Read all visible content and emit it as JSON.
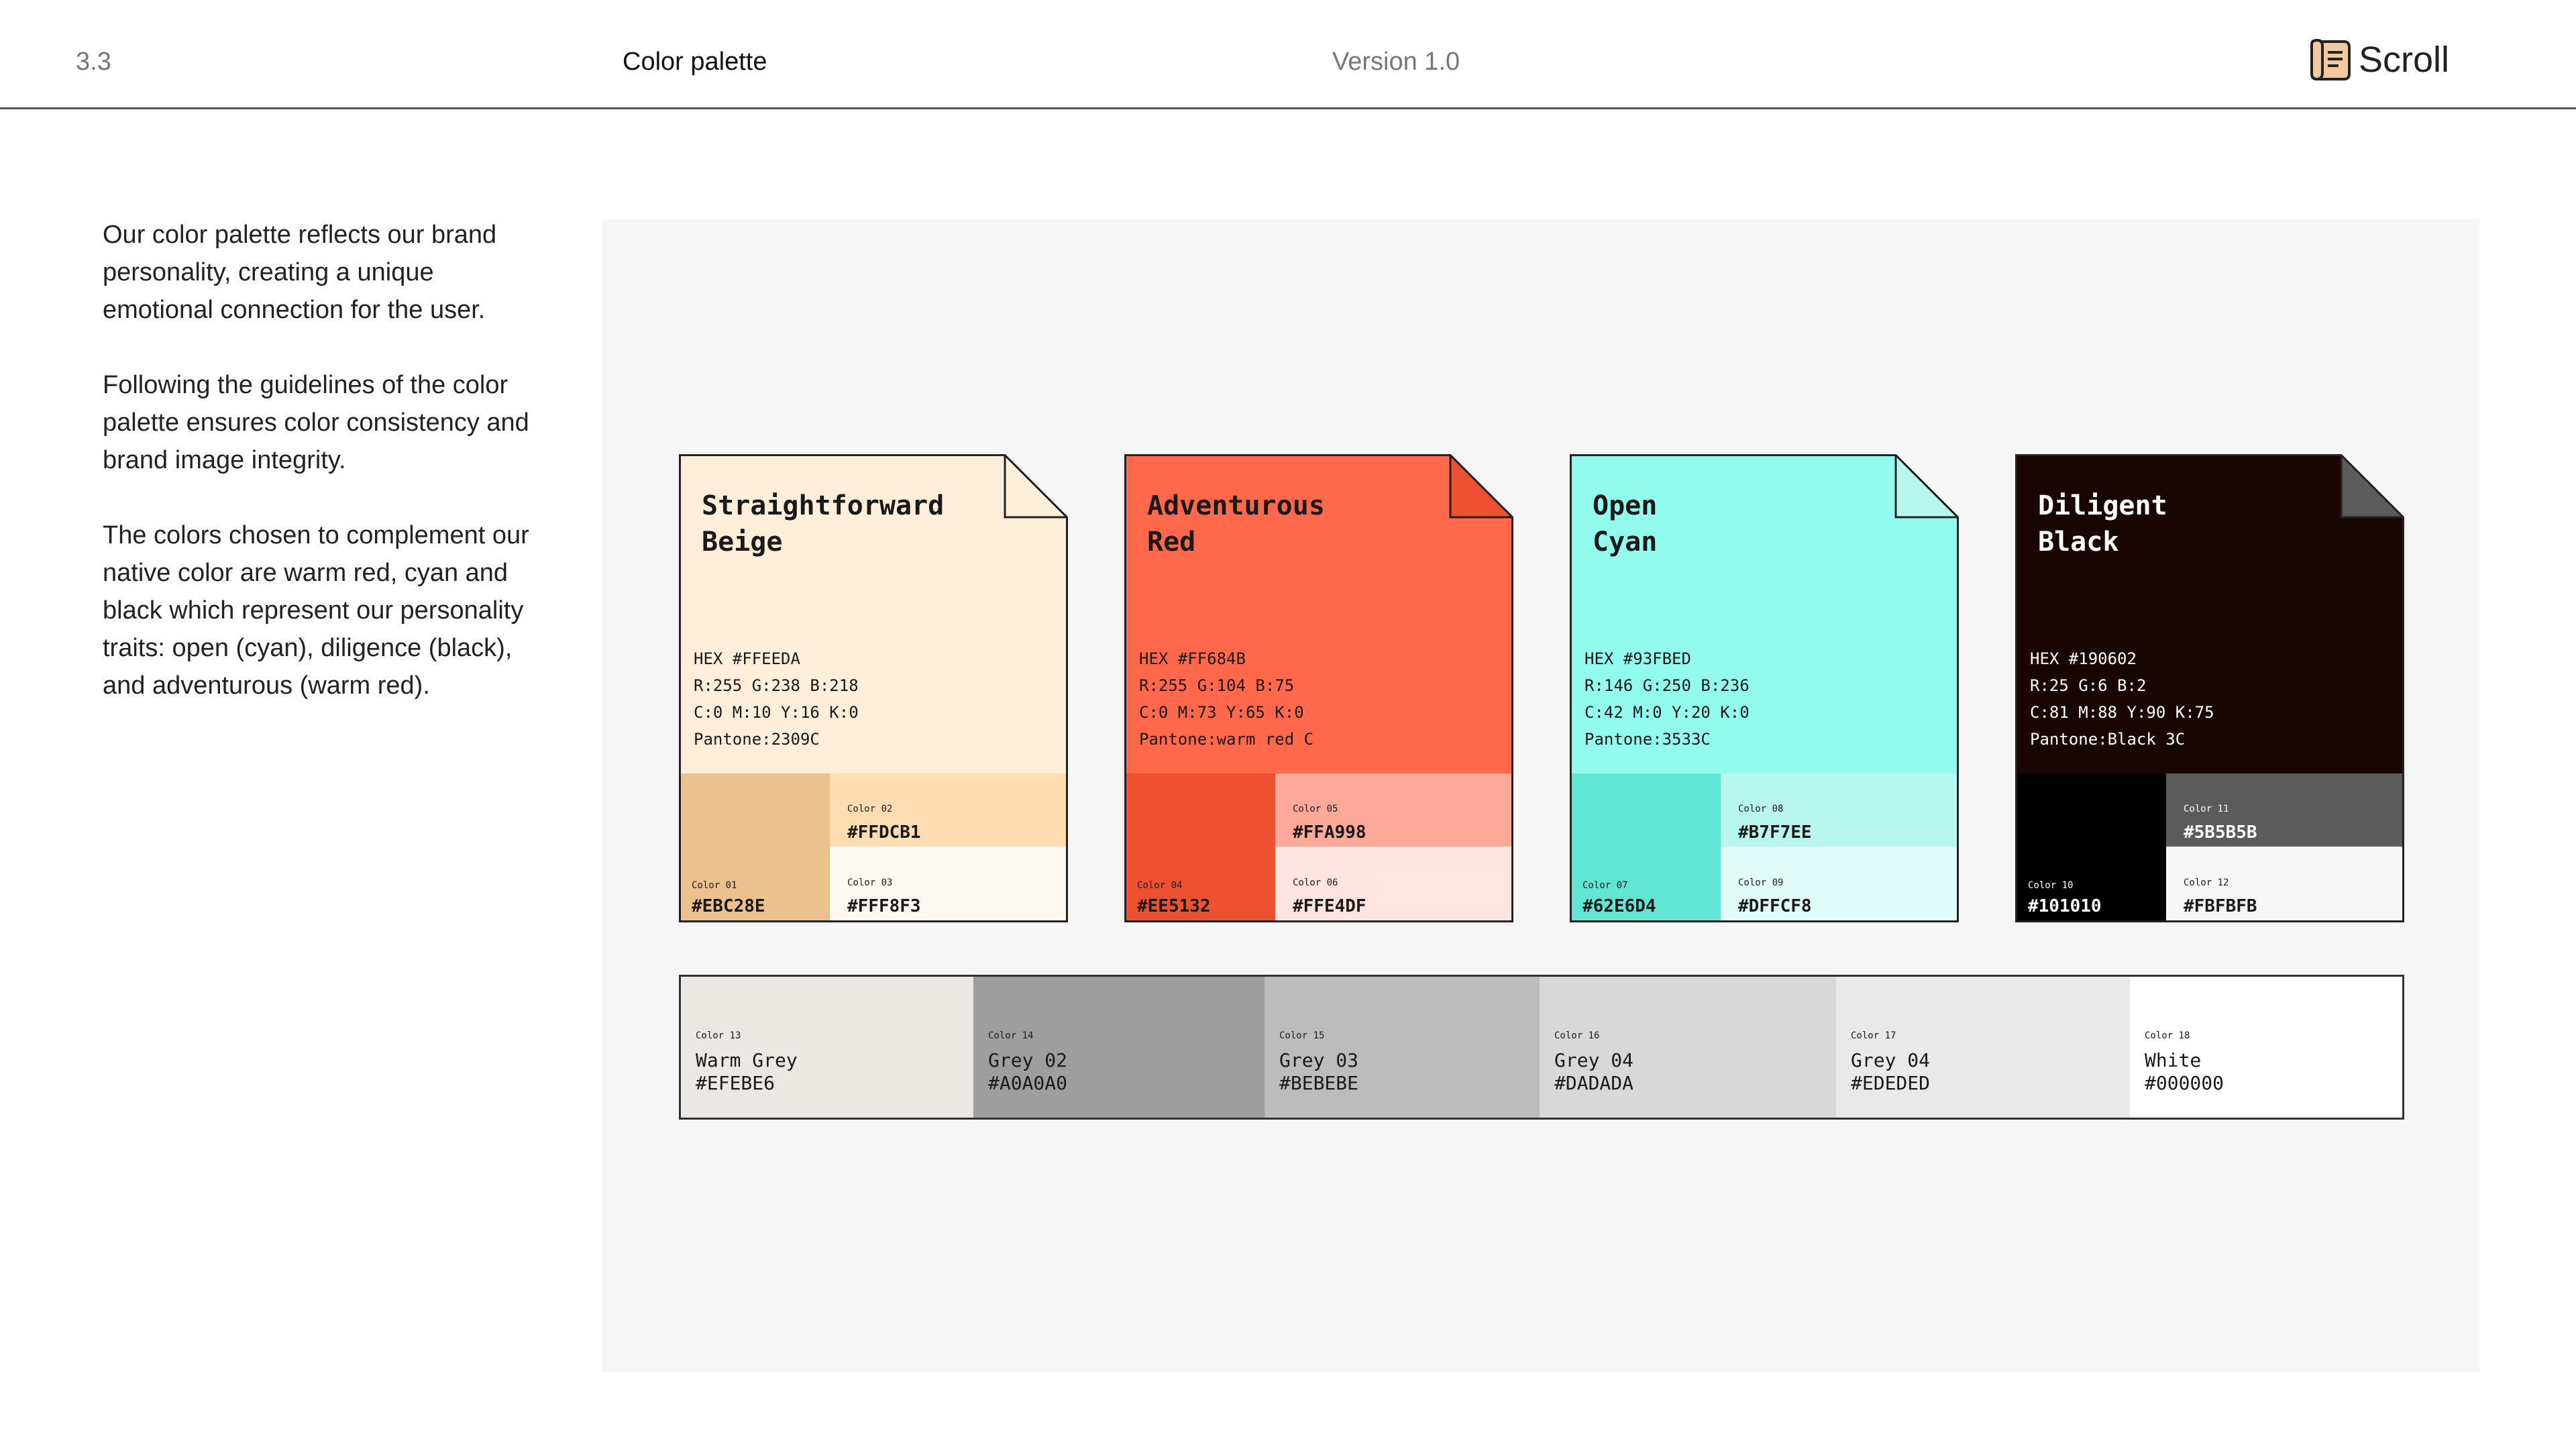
{
  "header": {
    "section_number": "3.3",
    "title": "Color palette",
    "version": "Version 1.0",
    "logo_text": "Scroll"
  },
  "intro": {
    "paragraphs": [
      "Our color palette reflects our brand personality, creating a unique emotional connection for the user.",
      "Following the guidelines of the color palette ensures color consistency and brand image integrity.",
      "The colors chosen to complement our native color are warm red, cyan and black which represent our personality traits: open (cyan), diligence (black), and adventurous (warm red)."
    ]
  },
  "cards": [
    {
      "name_line1": "Straightforward",
      "name_line2": "Beige",
      "hex": "HEX #FFEEDA",
      "rgb": "R:255 G:238 B:218",
      "cmyk": "C:0 M:10 Y:16 K:0",
      "pantone": "Pantone:2309C",
      "color": "#FFEEDA",
      "fold_color": "#FFEEDA",
      "text_color": "#1a1a1a",
      "swatches": [
        {
          "label": "Color 01",
          "hex": "#EBC28E",
          "color": "#EBC28E",
          "text_color": "#1a1a1a"
        },
        {
          "label": "Color 02",
          "hex": "#FFDCB1",
          "color": "#FFDCB1",
          "text_color": "#1a1a1a"
        },
        {
          "label": "Color 03",
          "hex": "#FFF8F3",
          "color": "#FFF8F3",
          "text_color": "#1a1a1a"
        }
      ]
    },
    {
      "name_line1": "Adventurous",
      "name_line2": "Red",
      "hex": "HEX #FF684B",
      "rgb": "R:255 G:104 B:75",
      "cmyk": "C:0 M:73 Y:65 K:0",
      "pantone": "Pantone:warm red C",
      "color": "#FF684B",
      "fold_color": "#EE5132",
      "text_color": "#1a1a1a",
      "swatches": [
        {
          "label": "Color 04",
          "hex": "#EE5132",
          "color": "#EE5132",
          "text_color": "#1a1a1a"
        },
        {
          "label": "Color 05",
          "hex": "#FFA998",
          "color": "#FFA998",
          "text_color": "#1a1a1a"
        },
        {
          "label": "Color 06",
          "hex": "#FFE4DF",
          "color": "#FFE4DF",
          "text_color": "#1a1a1a"
        }
      ]
    },
    {
      "name_line1": "Open",
      "name_line2": "Cyan",
      "hex": "HEX #93FBED",
      "rgb": "R:146 G:250 B:236",
      "cmyk": "C:42 M:0 Y:20 K:0",
      "pantone": "Pantone:3533C",
      "color": "#93FBED",
      "fold_color": "#B7F7EE",
      "text_color": "#1a1a1a",
      "swatches": [
        {
          "label": "Color 07",
          "hex": "#62E6D4",
          "color": "#62E6D4",
          "text_color": "#1a1a1a"
        },
        {
          "label": "Color 08",
          "hex": "#B7F7EE",
          "color": "#B7F7EE",
          "text_color": "#1a1a1a"
        },
        {
          "label": "Color 09",
          "hex": "#DFFCF8",
          "color": "#DFFCF8",
          "text_color": "#1a1a1a"
        }
      ]
    },
    {
      "name_line1": "Diligent",
      "name_line2": "Black",
      "hex": "HEX #190602",
      "rgb": "R:25 G:6 B:2",
      "cmyk": "C:81 M:88 Y:90 K:75",
      "pantone": "Pantone:Black 3C",
      "color": "#190602",
      "fold_color": "#5B5B5B",
      "text_color": "#ffffff",
      "swatches": [
        {
          "label": "Color 10",
          "hex": "#101010",
          "color": "#000000",
          "text_color": "#ffffff"
        },
        {
          "label": "Color 11",
          "hex": "#5B5B5B",
          "color": "#5B5B5B",
          "text_color": "#ffffff"
        },
        {
          "label": "Color 12",
          "hex": "#FBFBFB",
          "color": "#F7F7F7",
          "text_color": "#1a1a1a"
        }
      ]
    }
  ],
  "neutrals": [
    {
      "label": "Color 13",
      "name": "Warm Grey",
      "hex": "#EFEBE6",
      "color": "#EBE8E4"
    },
    {
      "label": "Color 14",
      "name": "Grey 02",
      "hex": "#A0A0A0",
      "color": "#9E9E9E"
    },
    {
      "label": "Color 15",
      "name": "Grey 03",
      "hex": "#BEBEBE",
      "color": "#BCBCBC"
    },
    {
      "label": "Color 16",
      "name": "Grey 04",
      "hex": "#DADADA",
      "color": "#D8D8D8"
    },
    {
      "label": "Color 17",
      "name": "Grey 04",
      "hex": "#EDEDED",
      "color": "#E9E9E9"
    },
    {
      "label": "Color 18",
      "name": "White",
      "hex": "#000000",
      "color": "#FFFFFF"
    }
  ]
}
